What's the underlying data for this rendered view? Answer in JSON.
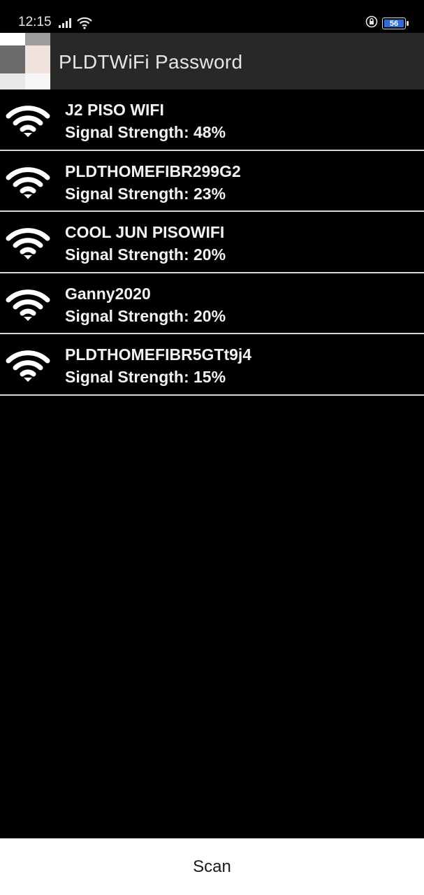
{
  "status_bar": {
    "time": "12:15",
    "battery": "56",
    "icons": [
      "signal-icon",
      "wifi-status-icon",
      "lock-rotation-icon",
      "battery-icon"
    ]
  },
  "app_bar": {
    "title": "PLDTWiFi Password"
  },
  "networks": [
    {
      "name": "J2 PISO WIFI",
      "strength": "Signal Strength: 48%"
    },
    {
      "name": "PLDTHOMEFIBR299G2",
      "strength": "Signal Strength: 23%"
    },
    {
      "name": "COOL JUN PISOWIFI",
      "strength": "Signal Strength: 20%"
    },
    {
      "name": "Ganny2020",
      "strength": "Signal Strength: 20%"
    },
    {
      "name": "PLDTHOMEFIBR5GTt9j4",
      "strength": "Signal Strength: 15%"
    }
  ],
  "scan": {
    "label": "Scan"
  },
  "colors": {
    "background": "#000000",
    "app_bar": "#282828",
    "divider": "#d7d7d7",
    "battery_fill": "#2f6bd8",
    "scan_bar": "#ffffff"
  }
}
